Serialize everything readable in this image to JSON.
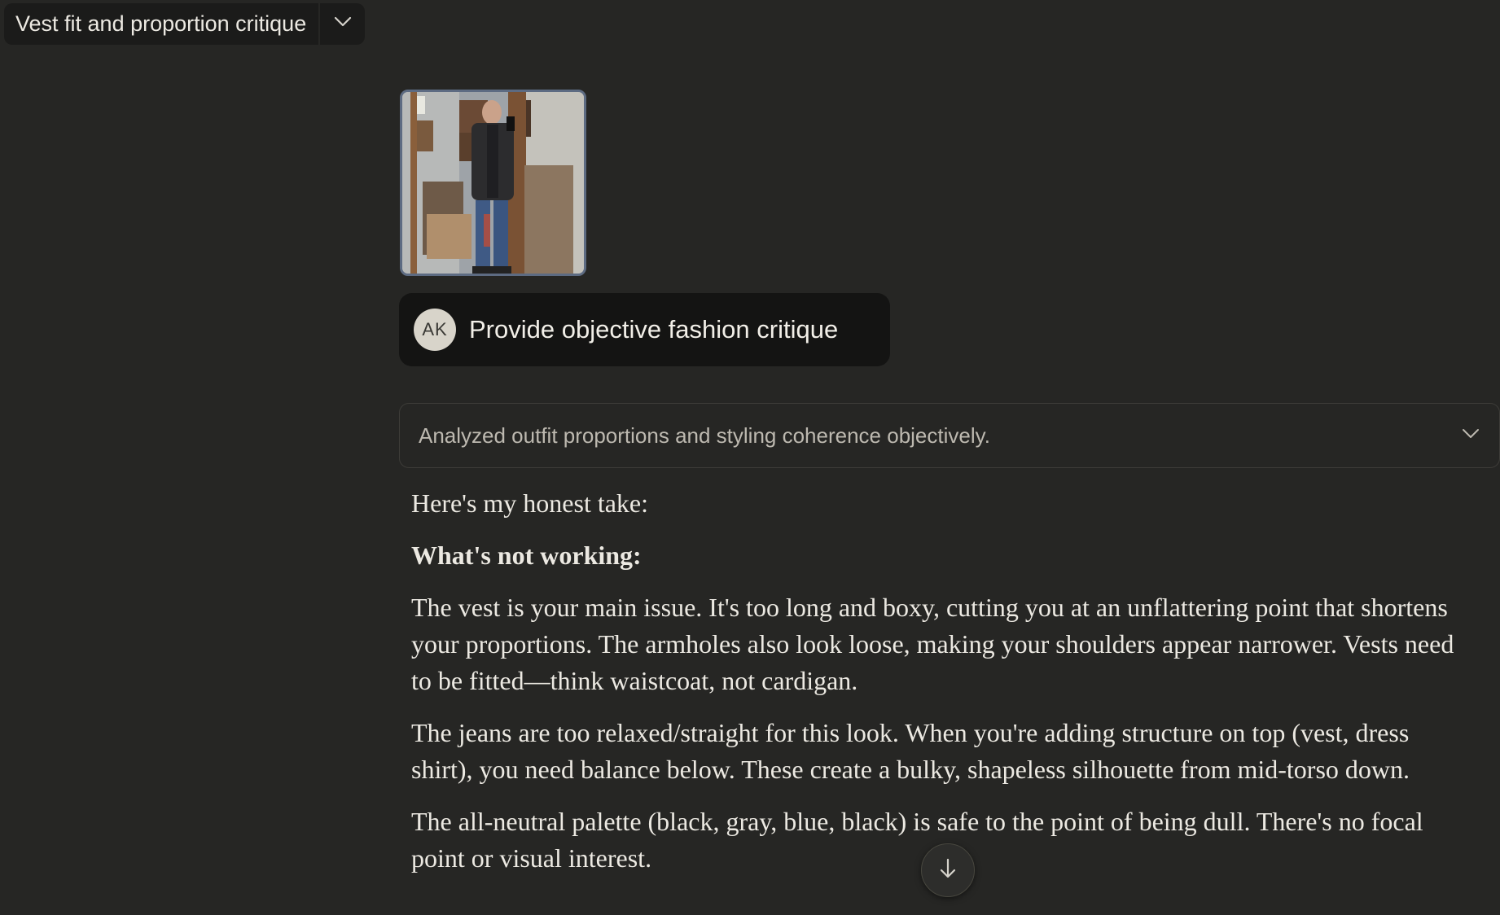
{
  "header": {
    "conversation_title": "Vest fit and proportion critique",
    "menu_icon": "chevron-down-icon"
  },
  "user_message": {
    "attachment_icon": "photo-thumbnail",
    "avatar_initials": "AK",
    "text": "Provide objective fashion critique"
  },
  "thinking": {
    "summary": "Analyzed outfit proportions and styling coherence objectively.",
    "expand_icon": "chevron-down-icon"
  },
  "response": {
    "intro": "Here's my honest take:",
    "heading": "What's not working:",
    "paragraphs": [
      "The vest is your main issue. It's too long and boxy, cutting you at an unflattering point that shortens your proportions. The armholes also look loose, making your shoulders appear narrower. Vests need to be fitted—think waistcoat, not cardigan.",
      "The jeans are too relaxed/straight for this look. When you're adding structure on top (vest, dress shirt), you need balance below. These create a bulky, shapeless silhouette from mid-torso down.",
      "The all-neutral palette (black, gray, blue, black) is safe to the point of being dull. There's no focal point or visual interest."
    ]
  },
  "scroll_button": {
    "icon": "arrow-down-icon"
  },
  "colors": {
    "background": "#262624",
    "user_bubble": "#141413",
    "text": "#ece9e2",
    "muted_text": "#bdb9b0"
  }
}
